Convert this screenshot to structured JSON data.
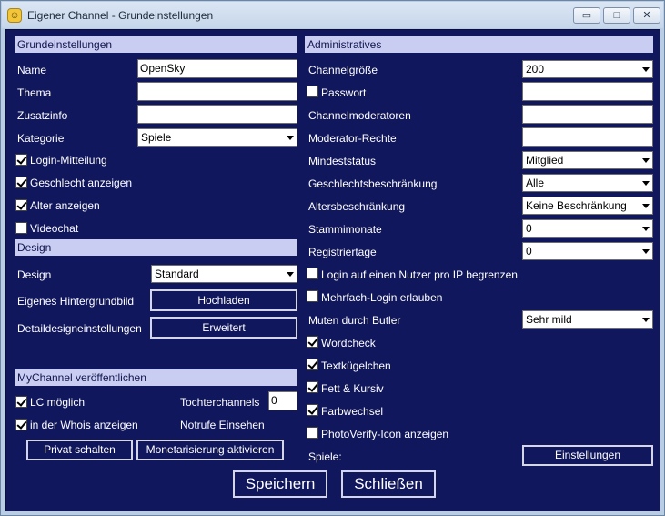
{
  "window": {
    "title": "Eigener Channel - Grundeinstellungen",
    "minimize": "▭",
    "maximize": "□",
    "close": "✕"
  },
  "left": {
    "section_grund": "Grundeinstellungen",
    "name_label": "Name",
    "name_value": "OpenSky",
    "thema_label": "Thema",
    "thema_value": "",
    "zusatz_label": "Zusatzinfo",
    "zusatz_value": "",
    "kategorie_label": "Kategorie",
    "kategorie_value": "Spiele",
    "login_mitteilung": "Login-Mitteilung",
    "geschlecht_anzeigen": "Geschlecht anzeigen",
    "alter_anzeigen": "Alter anzeigen",
    "videochat": "Videochat",
    "section_design": "Design",
    "design_label": "Design",
    "design_value": "Standard",
    "hintergrund_label": "Eigenes Hintergrundbild",
    "hochladen": "Hochladen",
    "detail_label": "Detaildesigneinstellungen",
    "erweitert": "Erweitert",
    "section_mychannel": "MyChannel veröffentlichen",
    "lc_moeglich": "LC möglich",
    "tochter_label": "Tochterchannels",
    "tochter_value": "0",
    "whois": "in der Whois anzeigen",
    "notrufe": "Notrufe Einsehen",
    "privat": "Privat schalten",
    "monetarisierung": "Monetarisierung aktivieren"
  },
  "right": {
    "section_admin": "Administratives",
    "channelgroesse_label": "Channelgröße",
    "channelgroesse_value": "200",
    "passwort": "Passwort",
    "moderatoren_label": "Channelmoderatoren",
    "rechte_label": "Moderator-Rechte",
    "mindeststatus_label": "Mindeststatus",
    "mindeststatus_value": "Mitglied",
    "geschlecht_label": "Geschlechtsbeschränkung",
    "geschlecht_value": "Alle",
    "alter_label": "Altersbeschränkung",
    "alter_value": "Keine Beschränkung",
    "stamm_label": "Stammimonate",
    "stamm_value": "0",
    "registrier_label": "Registriertage",
    "registrier_value": "0",
    "login_ip": "Login auf einen Nutzer pro IP begrenzen",
    "mehrfach": "Mehrfach-Login erlauben",
    "muten_label": "Muten durch Butler",
    "muten_value": "Sehr mild",
    "wordcheck": "Wordcheck",
    "textkuegelchen": "Textkügelchen",
    "fett": "Fett & Kursiv",
    "farbwechsel": "Farbwechsel",
    "photoverify": "PhotoVerify-Icon anzeigen",
    "spiele_label": "Spiele:",
    "einstellungen": "Einstellungen"
  },
  "footer": {
    "speichern": "Speichern",
    "schliessen": "Schließen"
  }
}
